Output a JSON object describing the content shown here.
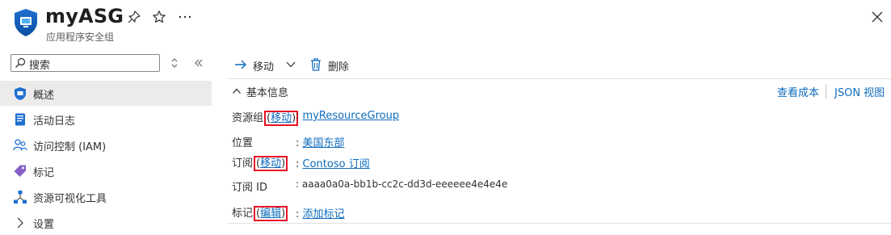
{
  "header": {
    "title": "myASG",
    "subtitle": "应用程序安全组",
    "icons": [
      "asg-shield-icon",
      "pin-icon",
      "star-icon",
      "more-icon",
      "close-icon"
    ]
  },
  "sidebar": {
    "search_placeholder": "搜索",
    "items": [
      {
        "label": "概述",
        "icon": "asg-shield-icon",
        "active": true
      },
      {
        "label": "活动日志",
        "icon": "log-icon"
      },
      {
        "label": "访问控制 (IAM)",
        "icon": "people-icon"
      },
      {
        "label": "标记",
        "icon": "tag-icon"
      },
      {
        "label": "资源可视化工具",
        "icon": "graph-icon"
      },
      {
        "label": "设置",
        "icon": "chevron-right-icon"
      }
    ]
  },
  "toolbar": {
    "move_label": "移动",
    "delete_label": "删除"
  },
  "essentials": {
    "toggle_label": "基本信息",
    "view_cost": "查看成本",
    "json_view": "JSON 视图",
    "rows": [
      {
        "label": "资源组",
        "action": "移动",
        "value": "myResourceGroup",
        "value_is_link": true
      },
      {
        "label": "位置",
        "action": "",
        "value": "美国东部",
        "value_is_link": true
      },
      {
        "label": "订阅",
        "action": "移动",
        "value": "Contoso 订阅",
        "value_is_link": true
      },
      {
        "label": "订阅 ID",
        "action": "",
        "value": "aaaa0a0a-bb1b-cc2c-dd3d-eeeeee4e4e4e",
        "value_is_link": false
      },
      {
        "label": "标记",
        "action": "编辑",
        "value": "添加标记",
        "value_is_link": true
      }
    ]
  },
  "colors": {
    "accent": "#0f6cbd",
    "highlight_box": "#e81123",
    "active_nav": "#edebe9"
  }
}
